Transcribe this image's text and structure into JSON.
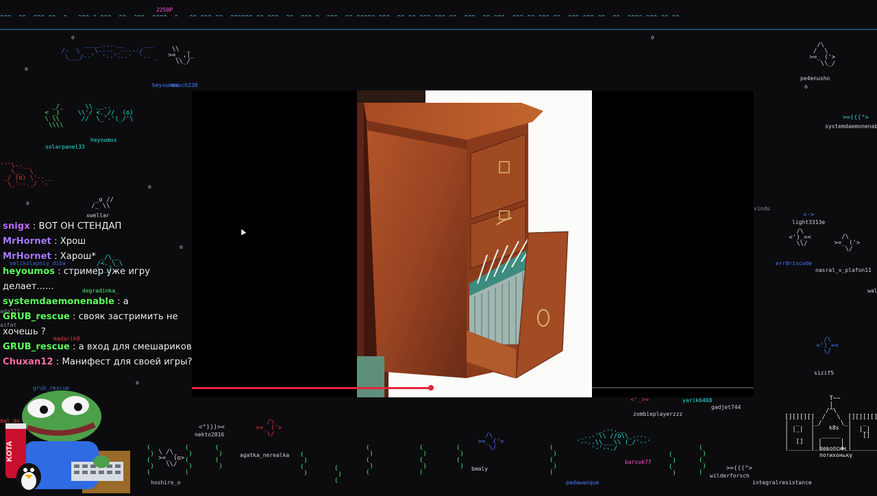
{
  "top_strip": {
    "text": "^^^  ^^  ^^^ ^^  ^   ^^^ ^ ^^^  ^^  ^^^  ^^^^  ^   ^^ ^^^ ^^  ^^^^^^ ^^ ^^^  ^^  ^^^ ^  ^^^  ^^ ^^^^^ ^^^  ^^ ^^ ^^^ ^^^ ^^  ^^^  ^^ ^^^  ^^^ ^^ ^^^ ^^  ^^^ ^^^ ^^  ^^  ^^^^ ^^^ ^^ ^^",
    "counter": "2250P"
  },
  "player": {
    "progress": 0.425
  },
  "chat": {
    "messages": [
      {
        "user": "snigx",
        "text": "ВОТ ОН СТЕНДАП",
        "color": "#c06cff"
      },
      {
        "user": "MrHornet",
        "text": "Хрош",
        "color": "#a879ff"
      },
      {
        "user": "MrHornet",
        "text": "Харош*",
        "color": "#a879ff"
      },
      {
        "user": "heyoumos",
        "text": "стример уже игру делает......",
        "color": "#5dff5d"
      },
      {
        "user": "systemdaemonenable",
        "text": "а",
        "color": "#5dff5d"
      },
      {
        "user": "GRUB_rescue",
        "text": "свояк застримить не хочешь ?",
        "color": "#5dff5d"
      },
      {
        "user": "GRUB_rescue",
        "text": "а вход для смешариков",
        "color": "#5dff5d"
      },
      {
        "user": "Chuxan12",
        "text": "Манифест для своей игры?",
        "color": "#ff6fa8"
      }
    ]
  },
  "nicknames": {
    "heyoumos_top": "heyoumos",
    "mmoch": "mmoch238",
    "solarpanel": "solarpanel33",
    "heyoumos_mid": "heyoumos",
    "xwellar": "xwellar",
    "velikolepniy": "velikolepniy_diba",
    "degradinka": "degradinka_",
    "madarik": "madarik8",
    "grub": "grub_rescue",
    "pe4enusho": "pe4enusho",
    "systemdaemonenable": "systemdaemonenable",
    "vindu": "vindu",
    "light": "light3313e",
    "err0rincode": "err0rincode",
    "nasral": "nasral_v_plafon11",
    "wal": "wal",
    "sizif": "sizif5",
    "yarik": "yarik6468",
    "zombie": "zombieplayerzzz",
    "gadjet": "gadjet744",
    "nekto": "nekto2016",
    "agatka": "agatka_nerealka",
    "bmaly": "bmaly",
    "hoshiro": "hoshiro_o",
    "padawanque": "padawanque",
    "barsuk": "barsuk77",
    "wilderforsch": "wilderforsch",
    "integral": "integralresistance",
    "k8s": "k8s",
    "castle_label_1": "девопсим",
    "castle_label_2": "потихоньку",
    "aifat": "aifat",
    "ada322": "ada322",
    "mal_do": "mal_do"
  },
  "can_label": "KOTA",
  "colors": {
    "accent_progress": "#e5243b",
    "ascii_cyan": "#24e0e0",
    "ascii_green": "#4cf27a"
  }
}
